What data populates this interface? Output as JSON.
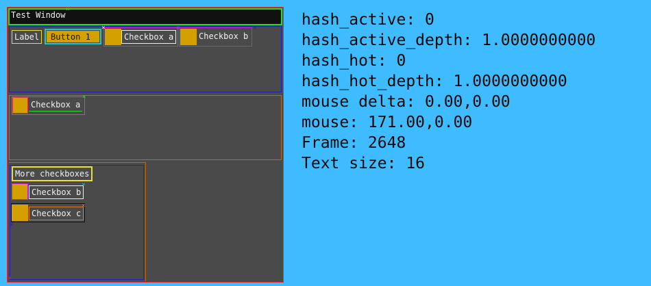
{
  "window": {
    "title": "Test Window",
    "label": "Label",
    "button1": "Button 1",
    "checkbox_a_top": "Checkbox a",
    "checkbox_b_top": "Checkbox b",
    "checkbox_a_mid": "Checkbox a",
    "more_header": "More checkboxes",
    "checkbox_b_low": "Checkbox b",
    "checkbox_c_low": "Checkbox c"
  },
  "debug": {
    "lines": [
      "hash_active: 0",
      "hash_active_depth: 1.0000000000",
      "hash_hot: 0",
      "hash_hot_depth: 1.0000000000",
      "mouse delta: 0.00,0.00",
      "mouse: 171.00,0.00",
      "Frame: 2648",
      "Text size: 16"
    ]
  },
  "colors": {
    "background": "#3ebcff",
    "window": "#4a4a4a",
    "accent": "#d4a000"
  }
}
